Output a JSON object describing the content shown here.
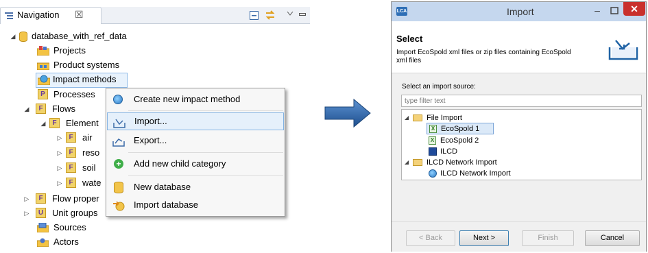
{
  "navigation": {
    "tab_title": "Navigation",
    "tab_close": "☒",
    "tree": {
      "root": "database_with_ref_data",
      "projects": "Projects",
      "product_systems": "Product systems",
      "impact_methods": "Impact methods",
      "processes": "Processes",
      "flows": "Flows",
      "elementary": "Element",
      "air": "air",
      "resources": "reso",
      "soil": "soil",
      "water": "wate",
      "flow_properties": "Flow proper",
      "unit_groups": "Unit groups",
      "sources": "Sources",
      "actors": "Actors"
    }
  },
  "context_menu": {
    "items": [
      {
        "label": "Create new impact method"
      },
      {
        "label": "Import..."
      },
      {
        "label": "Export..."
      },
      {
        "label": "Add new child category"
      },
      {
        "label": "New database"
      },
      {
        "label": "Import database"
      }
    ]
  },
  "import_dialog": {
    "logo": "LCA",
    "title": "Import",
    "heading": "Select",
    "description": "Import EcoSpold xml files or zip files containing EcoSpold xml files",
    "source_label": "Select an import source:",
    "filter_placeholder": "type filter text",
    "tree": {
      "file_import": "File Import",
      "ecospold1": "EcoSpold 1",
      "ecospold2": "EcoSpold 2",
      "ilcd": "ILCD",
      "ilcd_network_import": "ILCD Network Import",
      "ilcd_network_import_item": "ILCD Network Import"
    },
    "buttons": {
      "back": "< Back",
      "next": "Next >",
      "finish": "Finish",
      "cancel": "Cancel"
    }
  },
  "colors": {
    "selection_bg": "#e8f2fc",
    "selection_border": "#8cb8e6",
    "dialog_title_bg": "#c5d7ee",
    "close_button": "#c9302c",
    "arrow": "#2e68a8"
  }
}
